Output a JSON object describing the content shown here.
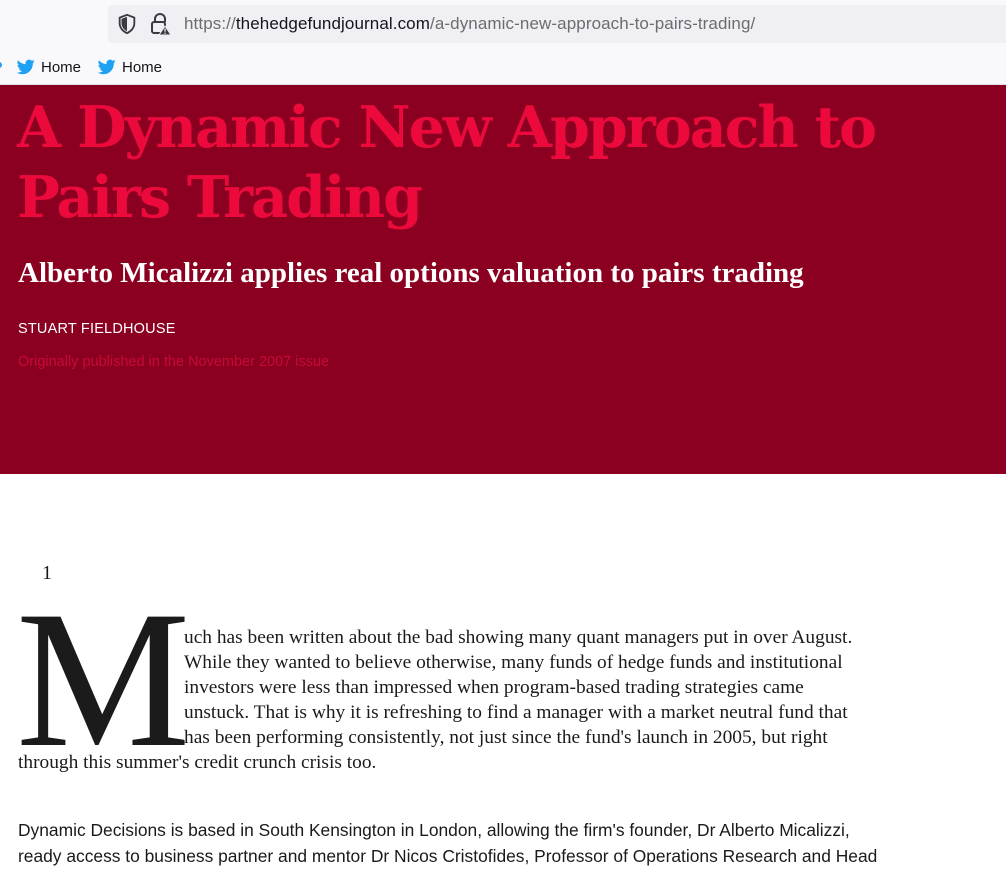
{
  "browser": {
    "url_prefix": "https://",
    "url_host": "thehedgefundjournal.com",
    "url_path": "/a-dynamic-new-approach-to-pairs-trading/",
    "bookmarks": [
      {
        "label": "Home",
        "icon": "twitter-icon"
      },
      {
        "label": "Home",
        "icon": "twitter-icon"
      }
    ]
  },
  "article": {
    "title_line1": "A Dynamic New Approach to",
    "title_line2": "Pairs Trading",
    "subtitle": "Alberto Micalizzi applies real options valuation to pairs trading",
    "author": "STUART FIELDHOUSE",
    "published": "Originally published in the November 2007 issue",
    "marker": "1",
    "drop_cap": "M",
    "para1_lines": [
      "uch has been written about the bad showing many quant managers put in over August.",
      "While they wanted to believe otherwise, many funds of hedge funds and institutional",
      "investors were less than impressed when program-based trading strategies came",
      "unstuck. That is why it is refreshing to find a manager with a market neutral fund that",
      "has been performing consistently, not just since the fund's launch in 2005, but right",
      "through this summer's credit crunch crisis too."
    ],
    "para2_lines": [
      "Dynamic Decisions is based in South Kensington in London, allowing the firm's founder, Dr Alberto Micalizzi,",
      "ready access to business partner and mentor Dr Nicos Cristofides, Professor of Operations Research and Head"
    ]
  },
  "colors": {
    "hero_bg": "#8b0020",
    "title": "#ec0a3c",
    "twitter": "#1da1f2"
  }
}
